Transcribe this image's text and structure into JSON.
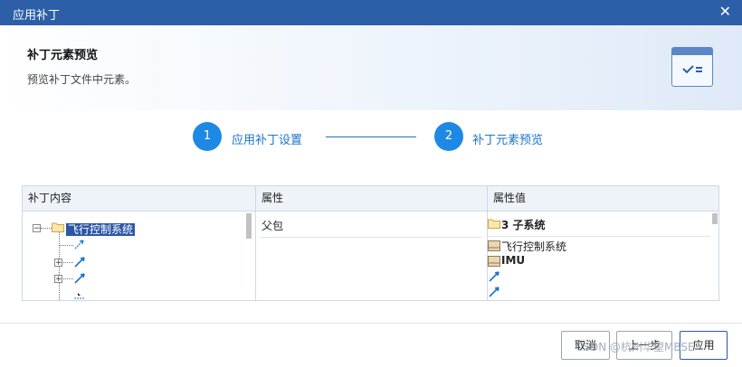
{
  "window": {
    "title": "应用补丁",
    "close_glyph": "✕"
  },
  "header": {
    "title": "补丁元素预览",
    "description": "预览补丁文件中元素。"
  },
  "steps": [
    {
      "number": "1",
      "label": "应用补丁设置"
    },
    {
      "number": "2",
      "label": "补丁元素预览"
    }
  ],
  "table": {
    "columns": [
      "补丁内容",
      "属性",
      "属性值"
    ],
    "tree_root_label": "飞行控制系统",
    "property": "父包",
    "values": [
      {
        "icon": "folder-icon",
        "text": "3 子系统"
      },
      {
        "icon": "block-icon",
        "text": "飞行控制系统"
      },
      {
        "icon": "block-icon",
        "text": "IMU"
      },
      {
        "icon": "connector-icon",
        "text": ""
      },
      {
        "icon": "connector-icon",
        "text": ""
      }
    ]
  },
  "buttons": {
    "cancel": "取消",
    "back": "上一步",
    "apply": "应用"
  },
  "watermark": "CSDN @杭州华望MBSE",
  "colors": {
    "titlebar": "#2d5fa8",
    "step_accent": "#1e88e5",
    "selection": "#2c57a6"
  }
}
